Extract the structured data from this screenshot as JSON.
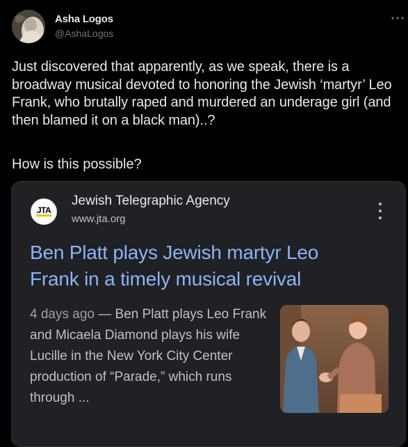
{
  "tweet": {
    "author_name": "Asha Logos",
    "author_handle": "@AshaLogos",
    "text": "Just discovered that apparently, as we speak, there is a broadway musical devoted to honoring the Jewish ‘martyr’ Leo Frank, who brutally raped and murdered an underage girl (and then blamed it on a black man)..?",
    "text2": "How is this possible?",
    "more_icon": "more-horizontal-icon"
  },
  "card": {
    "source_logo_text": "JTA",
    "source_name": "Jewish Telegraphic Agency",
    "source_url": "www.jta.org",
    "headline": "Ben Platt plays Jewish martyr Leo Frank in a timely musical revival",
    "date": "4 days ago",
    "separator": " — ",
    "snippet": "Ben Platt plays Leo Frank and Micaela Diamond plays his wife Lucille in the New York City Center production of “Parade,” which runs through ...",
    "menu_icon": "more-vertical-icon"
  },
  "colors": {
    "background": "#000000",
    "card_background": "#202124",
    "headline_link": "#8ab4f8",
    "secondary_text": "#71767b"
  }
}
